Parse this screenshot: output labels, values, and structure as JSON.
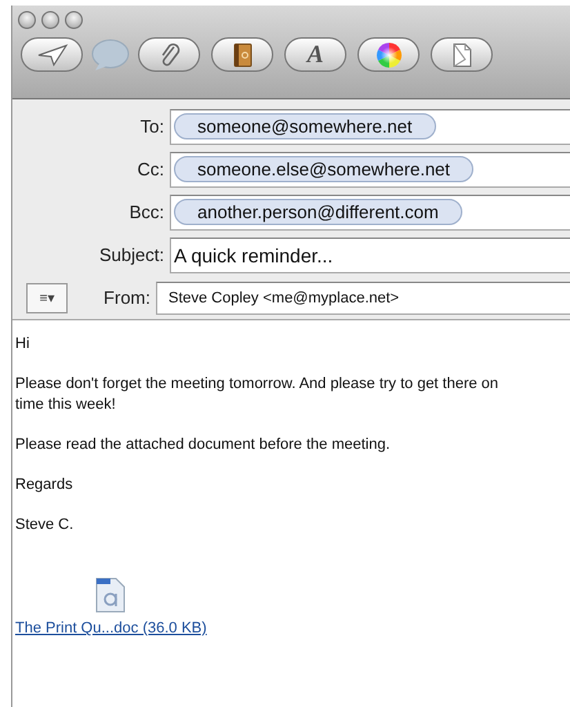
{
  "toolbar": {
    "buttons": [
      {
        "kind": "send"
      },
      {
        "kind": "chat"
      },
      {
        "kind": "attach"
      },
      {
        "kind": "address"
      },
      {
        "kind": "fonts",
        "glyph": "A"
      },
      {
        "kind": "colors"
      },
      {
        "kind": "stationery"
      }
    ]
  },
  "header": {
    "recipients": [
      {
        "label": "To:",
        "address": "someone@somewhere.net"
      },
      {
        "label": "Cc:",
        "address": "someone.else@somewhere.net"
      },
      {
        "label": "Bcc:",
        "address": "another.person@different.com"
      }
    ],
    "subject": {
      "label": "Subject:",
      "value": "A quick reminder..."
    },
    "format_menu": "≡▾",
    "from": {
      "label": "From:",
      "value": "Steve Copley <me@myplace.net>"
    }
  },
  "body": {
    "paragraphs": [
      "Hi",
      "Please don't forget the meeting tomorrow. And please try to get there on time this week!",
      "Please read the attached document before the meeting.",
      "Regards",
      "Steve C."
    ],
    "attachment": {
      "link": "The Print Qu...doc (36.0 KB)"
    }
  }
}
